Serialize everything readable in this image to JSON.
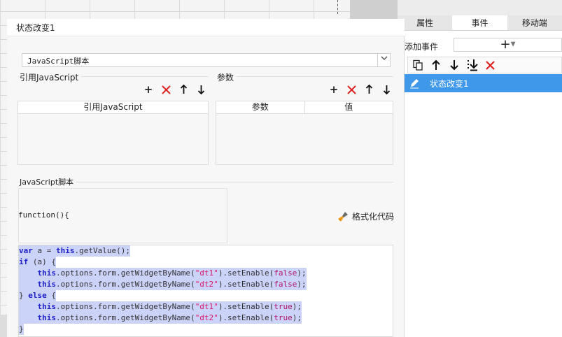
{
  "dialog": {
    "title": "状态改变1",
    "script_type": "JavaScript脚本",
    "ref_section_title": "引用JavaScript",
    "params_section_title": "参数",
    "ref_table_header": "引用JavaScript",
    "params_table_headers": [
      "参数",
      "值"
    ],
    "script_section_title": "JavaScript脚本",
    "function_signature": "function(){",
    "format_code_label": "格式化代码",
    "code_lines": [
      "var a = this.getValue();",
      "if (a) {",
      "    this.options.form.getWidgetByName(\"dt1\").setEnable(false);",
      "    this.options.form.getWidgetByName(\"dt2\").setEnable(false);",
      "} else {",
      "    this.options.form.getWidgetByName(\"dt1\").setEnable(true);",
      "    this.options.form.getWidgetByName(\"dt2\").setEnable(true);",
      "}"
    ]
  },
  "right_panel": {
    "tabs": [
      "属性",
      "事件",
      "移动端"
    ],
    "active_tab": "事件",
    "add_event_label": "添加事件",
    "add_event_symbol": "+",
    "toolbar_icons": [
      "copy-icon",
      "move-up-icon",
      "move-down-icon",
      "move-bottom-icon",
      "delete-icon"
    ],
    "events": [
      {
        "label": "状态改变1",
        "icon": "pencil-icon",
        "selected": true
      }
    ]
  },
  "colors": {
    "selection": "#ccd3f8",
    "keyword": "#1f22c9",
    "string": "#d9186d",
    "delete": "#e02020",
    "selected_row": "#3f98ea"
  }
}
